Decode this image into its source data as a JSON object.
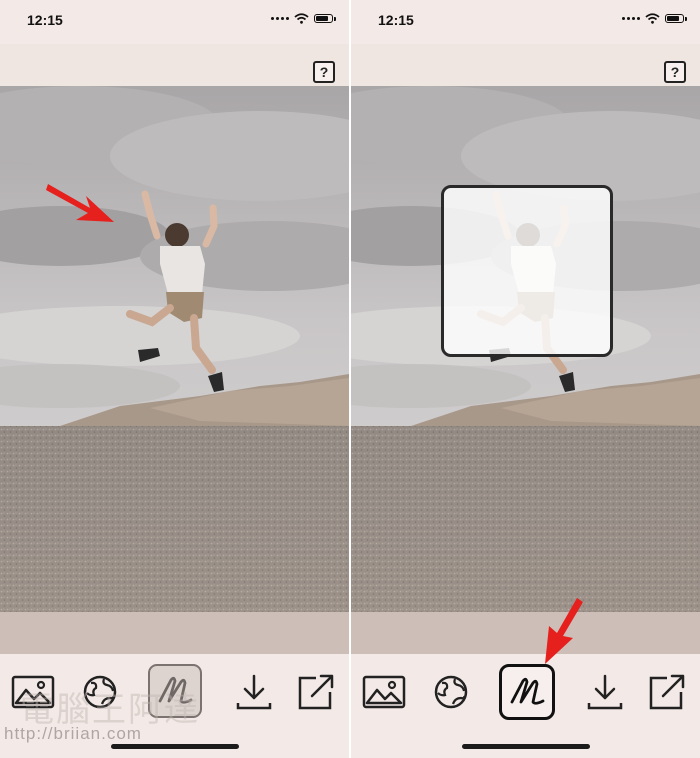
{
  "left_screen": {
    "status": {
      "time": "12:15"
    },
    "help_label": "?",
    "toolbar": {
      "items": [
        "photo-library",
        "globe",
        "scribble-draw",
        "download",
        "share"
      ],
      "selected": "scribble-draw"
    },
    "annotation": "red arrow pointing at sky area"
  },
  "right_screen": {
    "status": {
      "time": "12:15"
    },
    "help_label": "?",
    "toolbar": {
      "items": [
        "photo-library",
        "globe",
        "scribble-draw",
        "download",
        "share"
      ],
      "selected": "scribble-draw"
    },
    "overlay": "white translucent selection square over subject",
    "annotation": "red arrow pointing at draw tool"
  },
  "watermark": {
    "cjk": "電腦王阿達",
    "url": "http://briian.com"
  },
  "colors": {
    "arrow": "#e5201d",
    "bar": "#f3e9e6",
    "photo_strip": "#cdbfb8"
  }
}
